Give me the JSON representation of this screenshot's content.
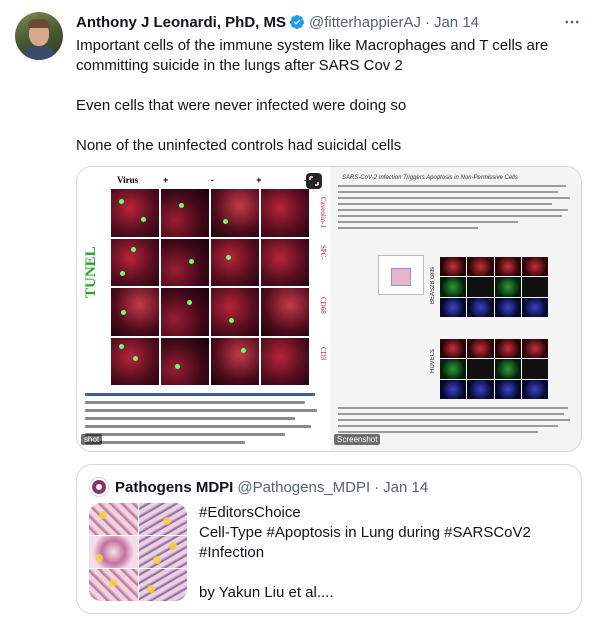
{
  "tweet": {
    "author": {
      "display_name": "Anthony J Leonardi, PhD, MS",
      "handle": "@fitterhappierAJ",
      "separator": "·",
      "date": "Jan 14",
      "verified_icon": "verified-badge-icon",
      "verified_color": "#1d9bf0"
    },
    "more_icon": "more-horizontal-icon",
    "text": {
      "line1": "Important cells of the immune system like Macrophages and T cells are",
      "line2": "committing suicide in the lungs after SARS Cov 2",
      "line3": "Even cells that were never infected were doing so",
      "line4": "None of the uninfected controls had suicidal cells"
    },
    "media": {
      "left_image": {
        "stain_label": "TUNEL",
        "virus_label": "Virus",
        "virus_signs": "+ - + -",
        "row_labels": [
          "Caveolin-1",
          "SPC-",
          "CD68",
          "CD3"
        ],
        "expand_icon": "expand-icon",
        "shot_tag": "shot"
      },
      "right_image": {
        "heading": "SARS-CoV-2 Infection Triggers Apoptosis in Non-Permissive Cells",
        "row_label_b": "BEAS2B cells",
        "row_label_c": "HUVECs",
        "tag": "Screenshot"
      }
    }
  },
  "quote": {
    "avatar_icon": "pathogens-logo-icon",
    "display_name": "Pathogens MDPI",
    "handle": "@Pathogens_MDPI",
    "separator": "·",
    "date": "Jan 14",
    "text": {
      "line1": "#EditorsChoice",
      "line2": "Cell-Type #Apoptosis in Lung during #SARSCoV2",
      "line3": "#Infection",
      "line4": "by Yakun Liu et al...."
    }
  },
  "colors": {
    "text_primary": "#0f1419",
    "text_secondary": "#536471",
    "border": "#cfd9de",
    "accent": "#1d9bf0"
  }
}
